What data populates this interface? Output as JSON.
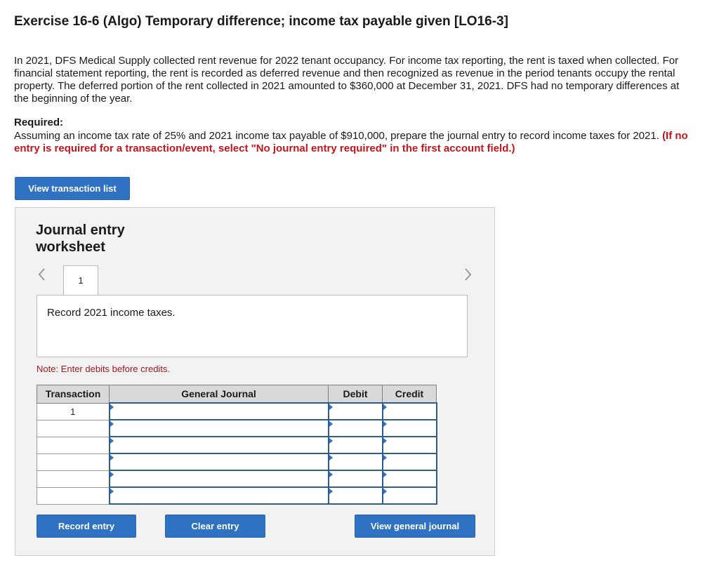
{
  "header": {
    "title": "Exercise 16-6 (Algo) Temporary difference; income tax payable given [LO16-3]"
  },
  "problem": {
    "intro": "In 2021, DFS Medical Supply collected rent revenue for 2022 tenant occupancy. For income tax reporting, the rent is taxed when collected. For financial statement reporting, the rent is recorded as deferred revenue and then recognized as revenue in the period tenants occupy the rental property. The deferred portion of the rent collected in 2021 amounted to $360,000 at December 31, 2021. DFS had no temporary differences at the beginning of the year.",
    "required_label": "Required:",
    "required_text": "Assuming an income tax rate of 25% and 2021 income tax payable of $910,000, prepare the journal entry to record income taxes for 2021.",
    "instruction": "(If no entry is required for a transaction/event, select \"No journal entry required\" in the first account field.)"
  },
  "buttons": {
    "view_transactions": "View transaction list",
    "record_entry": "Record entry",
    "clear_entry": "Clear entry",
    "view_general_journal": "View general journal"
  },
  "worksheet": {
    "title_line1": "Journal entry",
    "title_line2": "worksheet",
    "tab_number": "1",
    "description": "Record 2021 income taxes.",
    "note": "Note: Enter debits before credits.",
    "columns": [
      "Transaction",
      "General Journal",
      "Debit",
      "Credit"
    ],
    "rows": [
      {
        "transaction": "1",
        "account": "",
        "debit": "",
        "credit": ""
      },
      {
        "transaction": "",
        "account": "",
        "debit": "",
        "credit": ""
      },
      {
        "transaction": "",
        "account": "",
        "debit": "",
        "credit": ""
      },
      {
        "transaction": "",
        "account": "",
        "debit": "",
        "credit": ""
      },
      {
        "transaction": "",
        "account": "",
        "debit": "",
        "credit": ""
      },
      {
        "transaction": "",
        "account": "",
        "debit": "",
        "credit": ""
      }
    ]
  },
  "icons": {
    "prev": "chevron-left-icon",
    "next": "chevron-right-icon"
  }
}
